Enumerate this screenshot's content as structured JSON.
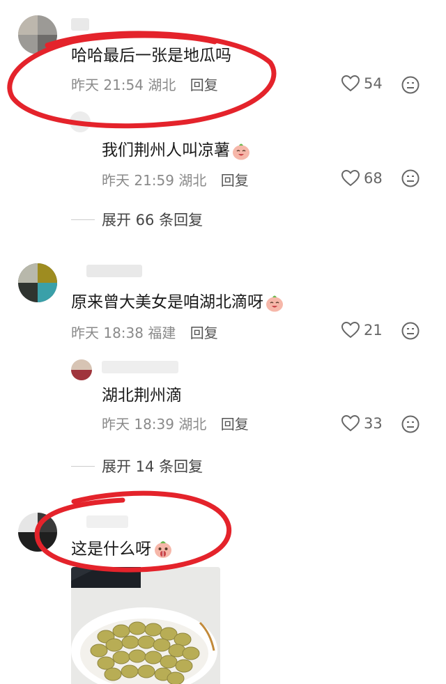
{
  "comments": [
    {
      "text": "哈哈最后一张是地瓜吗",
      "date": "昨天 21:54",
      "location": "湖北",
      "reply_label": "回复",
      "likes": "54",
      "replies": [
        {
          "text": "我们荆州人叫凉薯",
          "date": "昨天 21:59",
          "location": "湖北",
          "reply_label": "回复",
          "likes": "68"
        }
      ],
      "expand_label": "展开 66 条回复"
    },
    {
      "text": "原来曾大美女是咱湖北滴呀",
      "date": "昨天 18:38",
      "location": "福建",
      "reply_label": "回复",
      "likes": "21",
      "replies": [
        {
          "text": "湖北荆州滴",
          "date": "昨天 18:39",
          "location": "湖北",
          "reply_label": "回复",
          "likes": "33"
        }
      ],
      "expand_label": "展开 14 条回复"
    },
    {
      "text": "这是什么呀"
    }
  ],
  "colors": {
    "highlight": "#e4232b",
    "like": "#666666",
    "meta": "#8a8a8a"
  },
  "icons": [
    "heart-icon",
    "dislike-face-icon",
    "laughing-emoji-icon",
    "shocked-emoji-icon"
  ]
}
